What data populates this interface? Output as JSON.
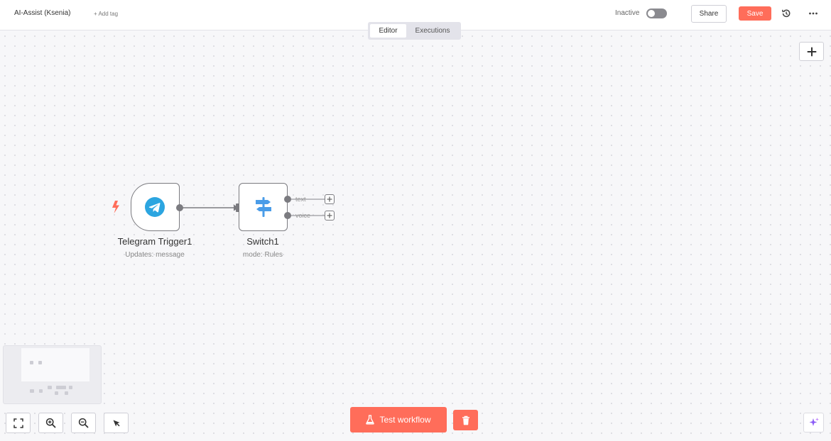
{
  "header": {
    "workflow_title": "AI-Assist (Ksenia)",
    "add_tag_label": "+ Add tag",
    "status_label": "Inactive",
    "share_label": "Share",
    "save_label": "Save"
  },
  "tabs": [
    {
      "label": "Editor",
      "active": true
    },
    {
      "label": "Executions",
      "active": false
    }
  ],
  "nodes": {
    "trigger": {
      "title": "Telegram Trigger1",
      "subtitle": "Updates: message"
    },
    "switch": {
      "title": "Switch1",
      "subtitle": "mode: Rules",
      "outputs": [
        "text",
        "voice"
      ]
    }
  },
  "footer": {
    "test_label": "Test workflow"
  },
  "icons": {
    "trigger_bolt": "lightning-bolt-icon",
    "telegram": "telegram-icon",
    "switch": "signpost-icon",
    "history": "history-icon",
    "more": "ellipsis-icon",
    "add": "plus-icon",
    "fit": "fit-view-icon",
    "zoom_in": "zoom-in-icon",
    "zoom_out": "zoom-out-icon",
    "cursor": "cursor-icon",
    "test": "flask-icon",
    "trash": "trash-icon",
    "ai": "sparkle-icon"
  },
  "colors": {
    "accent": "#ff6d5a",
    "telegram": "#2ca5e0",
    "switch": "#4a9ce8"
  }
}
